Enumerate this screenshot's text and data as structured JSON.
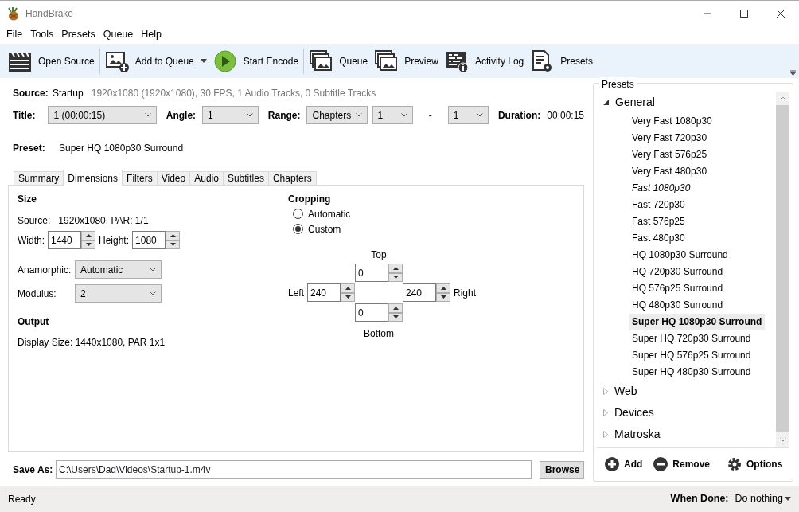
{
  "window": {
    "title": "HandBrake"
  },
  "menu": [
    {
      "label": "File"
    },
    {
      "label": "Tools"
    },
    {
      "label": "Presets"
    },
    {
      "label": "Queue"
    },
    {
      "label": "Help"
    }
  ],
  "toolbar": [
    {
      "label": "Open Source",
      "kind": "button"
    },
    {
      "label": "Add to Queue",
      "kind": "dropdown"
    },
    {
      "label": "Start Encode",
      "kind": "button"
    },
    {
      "label": "Queue",
      "kind": "button"
    },
    {
      "label": "Preview",
      "kind": "button"
    },
    {
      "label": "Activity Log",
      "kind": "button"
    },
    {
      "label": "Presets",
      "kind": "button"
    }
  ],
  "source": {
    "label": "Source:",
    "name": "Startup",
    "info": "1920x1080 (1920x1080), 30 FPS, 1 Audio Tracks, 0 Subtitle Tracks"
  },
  "title_row": [
    {
      "kind": "select",
      "label": "Title:",
      "value": "1  (00:00:15)"
    },
    {
      "kind": "select",
      "label": "Angle:",
      "value": "1"
    },
    {
      "kind": "select",
      "label": "Range:",
      "value": "Chapters"
    },
    {
      "kind": "select",
      "value": "1"
    },
    {
      "kind": "separator",
      "value": "-"
    },
    {
      "kind": "select",
      "value": "1"
    },
    {
      "kind": "text",
      "label": "Duration:",
      "value": "00:00:15"
    }
  ],
  "preset": {
    "label": "Preset:",
    "value": "Super HQ 1080p30 Surround"
  },
  "tabs": [
    {
      "label": "Summary",
      "selected": false
    },
    {
      "label": "Dimensions",
      "selected": true
    },
    {
      "label": "Filters",
      "selected": false
    },
    {
      "label": "Video",
      "selected": false
    },
    {
      "label": "Audio",
      "selected": false
    },
    {
      "label": "Subtitles",
      "selected": false
    },
    {
      "label": "Chapters",
      "selected": false
    }
  ],
  "dimensions": {
    "size": {
      "title": "Size",
      "source_label": "Source:",
      "source_value": "1920x1080, PAR: 1/1",
      "width": {
        "label": "Width:",
        "value": "1440"
      },
      "height": {
        "label": "Height:",
        "value": "1080"
      },
      "anamorphic": {
        "label": "Anamorphic:",
        "value": "Automatic"
      },
      "modulus": {
        "label": "Modulus:",
        "value": "2"
      }
    },
    "output": {
      "title": "Output",
      "display_size": "Display Size: 1440x1080,  PAR 1x1"
    },
    "cropping": {
      "title": "Cropping",
      "options": [
        {
          "label": "Automatic",
          "selected": false
        },
        {
          "label": "Custom",
          "selected": true
        }
      ],
      "top": {
        "label": "Top",
        "value": "0"
      },
      "left": {
        "label": "Left",
        "value": "240"
      },
      "right": {
        "label": "Right",
        "value": "240"
      },
      "bottom": {
        "label": "Bottom",
        "value": "0"
      }
    }
  },
  "save_as": {
    "label": "Save As:",
    "value": "C:\\Users\\Dad\\Videos\\Startup-1.m4v",
    "button": "Browse"
  },
  "presets": {
    "title": "Presets",
    "groups": [
      {
        "label": "General",
        "expanded": true,
        "items": [
          {
            "label": "Very Fast 1080p30",
            "selected": false,
            "default": false
          },
          {
            "label": "Very Fast 720p30",
            "selected": false,
            "default": false
          },
          {
            "label": "Very Fast 576p25",
            "selected": false,
            "default": false
          },
          {
            "label": "Very Fast 480p30",
            "selected": false,
            "default": false
          },
          {
            "label": "Fast 1080p30",
            "selected": false,
            "default": true
          },
          {
            "label": "Fast 720p30",
            "selected": false,
            "default": false
          },
          {
            "label": "Fast 576p25",
            "selected": false,
            "default": false
          },
          {
            "label": "Fast 480p30",
            "selected": false,
            "default": false
          },
          {
            "label": "HQ 1080p30 Surround",
            "selected": false,
            "default": false
          },
          {
            "label": "HQ 720p30 Surround",
            "selected": false,
            "default": false
          },
          {
            "label": "HQ 576p25 Surround",
            "selected": false,
            "default": false
          },
          {
            "label": "HQ 480p30 Surround",
            "selected": false,
            "default": false
          },
          {
            "label": "Super HQ 1080p30 Surround",
            "selected": true,
            "default": false
          },
          {
            "label": "Super HQ 720p30 Surround",
            "selected": false,
            "default": false
          },
          {
            "label": "Super HQ 576p25 Surround",
            "selected": false,
            "default": false
          },
          {
            "label": "Super HQ 480p30 Surround",
            "selected": false,
            "default": false
          }
        ]
      },
      {
        "label": "Web",
        "expanded": false
      },
      {
        "label": "Devices",
        "expanded": false
      },
      {
        "label": "Matroska",
        "expanded": false
      }
    ],
    "buttons": [
      {
        "label": "Add"
      },
      {
        "label": "Remove"
      },
      {
        "label": "Options"
      }
    ]
  },
  "status_bar": {
    "text": "Ready",
    "when_done_label": "When Done:",
    "when_done_value": "Do nothing"
  }
}
